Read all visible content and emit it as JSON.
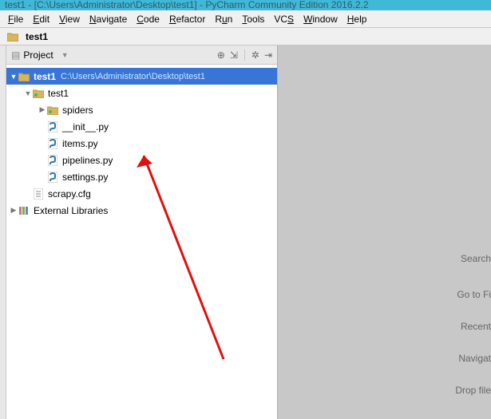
{
  "title": "test1 - [C:\\Users\\Administrator\\Desktop\\test1] - PyCharm Community Edition 2016.2.2",
  "menu": {
    "file": "File",
    "edit": "Edit",
    "view": "View",
    "navigate": "Navigate",
    "code": "Code",
    "refactor": "Refactor",
    "run": "Run",
    "tools": "Tools",
    "vcs": "VCS",
    "window": "Window",
    "help": "Help"
  },
  "breadcrumb": {
    "name": "test1"
  },
  "project_header": {
    "label": "Project"
  },
  "tree": {
    "root": {
      "name": "test1",
      "path": "C:\\Users\\Administrator\\Desktop\\test1"
    },
    "pkg": {
      "name": "test1"
    },
    "spiders": {
      "name": "spiders"
    },
    "init": {
      "name": "__init__.py"
    },
    "items": {
      "name": "items.py"
    },
    "pipelines": {
      "name": "pipelines.py"
    },
    "settings": {
      "name": "settings.py"
    },
    "scrapycfg": {
      "name": "scrapy.cfg"
    },
    "extlib": {
      "name": "External Libraries"
    }
  },
  "editor": {
    "search": "Search ",
    "goto": "Go to Fi",
    "recent": "Recent ",
    "navigat": "Navigat",
    "drop": "Drop file"
  }
}
